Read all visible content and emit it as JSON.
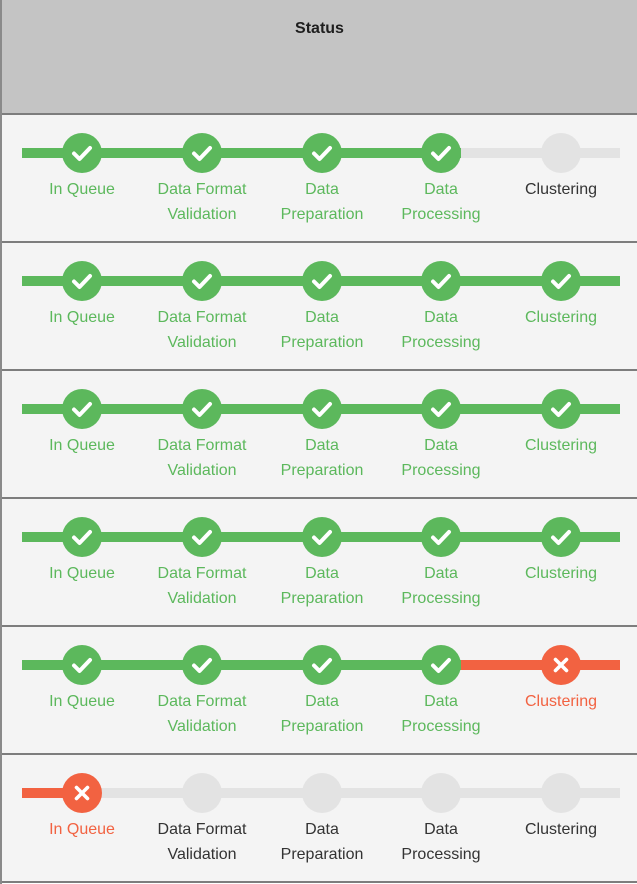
{
  "header": {
    "title": "Status"
  },
  "stages": [
    {
      "label_line1": "In Queue",
      "label_line2": ""
    },
    {
      "label_line1": "Data Format",
      "label_line2": "Validation"
    },
    {
      "label_line1": "Data",
      "label_line2": "Preparation"
    },
    {
      "label_line1": "Data",
      "label_line2": "Processing"
    },
    {
      "label_line1": "Clustering",
      "label_line2": ""
    }
  ],
  "colors": {
    "done": "#5cb85c",
    "failed": "#f26241",
    "pending": "#e3e3e3",
    "pending_text": "#333333"
  },
  "icons": {
    "done": "check-icon",
    "failed": "cross-icon"
  },
  "rows": [
    {
      "statuses": [
        "done",
        "done",
        "done",
        "done",
        "pending"
      ]
    },
    {
      "statuses": [
        "done",
        "done",
        "done",
        "done",
        "done"
      ]
    },
    {
      "statuses": [
        "done",
        "done",
        "done",
        "done",
        "done"
      ]
    },
    {
      "statuses": [
        "done",
        "done",
        "done",
        "done",
        "done"
      ]
    },
    {
      "statuses": [
        "done",
        "done",
        "done",
        "done",
        "failed"
      ]
    },
    {
      "statuses": [
        "failed",
        "pending",
        "pending",
        "pending",
        "pending"
      ]
    }
  ]
}
